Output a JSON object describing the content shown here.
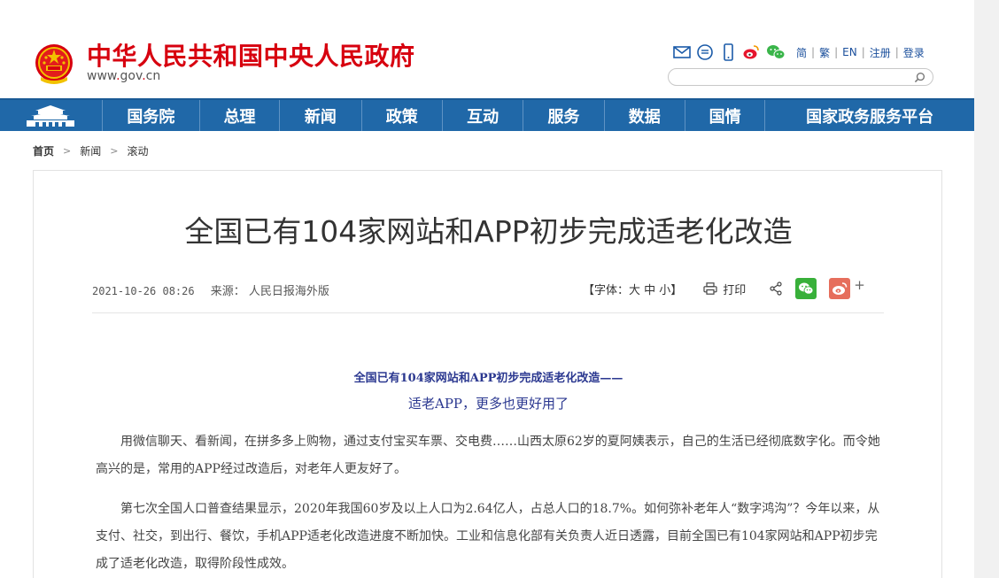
{
  "header": {
    "site_title": "中华人民共和国中央人民政府",
    "domain_prefix": "www",
    "domain_name": "gov",
    "domain_suffix": "cn",
    "toolbar": {
      "icons": [
        "mail-icon",
        "chat-bubble-icon",
        "mobile-icon",
        "weibo-icon",
        "wechat-icon"
      ],
      "links": [
        "简",
        "繁",
        "EN",
        "注册",
        "登录"
      ]
    },
    "search": {
      "placeholder": ""
    }
  },
  "nav": {
    "items": [
      "国务院",
      "总理",
      "新闻",
      "政策",
      "互动",
      "服务",
      "数据",
      "国情",
      "国家政务服务平台"
    ]
  },
  "breadcrumb": [
    "首页",
    "新闻",
    "滚动"
  ],
  "article": {
    "title": "全国已有104家网站和APP初步完成适老化改造",
    "date": "2021-10-26 08:26",
    "source_label": "来源：",
    "source": "人民日报海外版",
    "font_label": "【字体：大 中 小】",
    "print_label": "打印",
    "subtitle1": "全国已有104家网站和APP初步完成适老化改造——",
    "subtitle2": "适老APP，更多也更好用了",
    "paragraphs": [
      "用微信聊天、看新闻，在拼多多上购物，通过支付宝买车票、交电费……山西太原62岁的夏阿姨表示，自己的生活已经彻底数字化。而令她高兴的是，常用的APP经过改造后，对老年人更友好了。",
      "第七次全国人口普查结果显示，2020年我国60岁及以上人口为2.64亿人，占总人口的18.7%。如何弥补老年人“数字鸿沟”？今年以来，从支付、社交，到出行、餐饮，手机APP适老化改造进度不断加快。工业和信息化部有关负责人近日透露，目前全国已有104家网站和APP初步完成了适老化改造，取得阶段性成效。"
    ]
  },
  "colors": {
    "brand_red": "#d7000f",
    "nav_blue": "#2068a8",
    "subtitle_blue": "#2b3890",
    "wechat_green": "#38b03a",
    "weibo_red": "#e66e5c"
  }
}
